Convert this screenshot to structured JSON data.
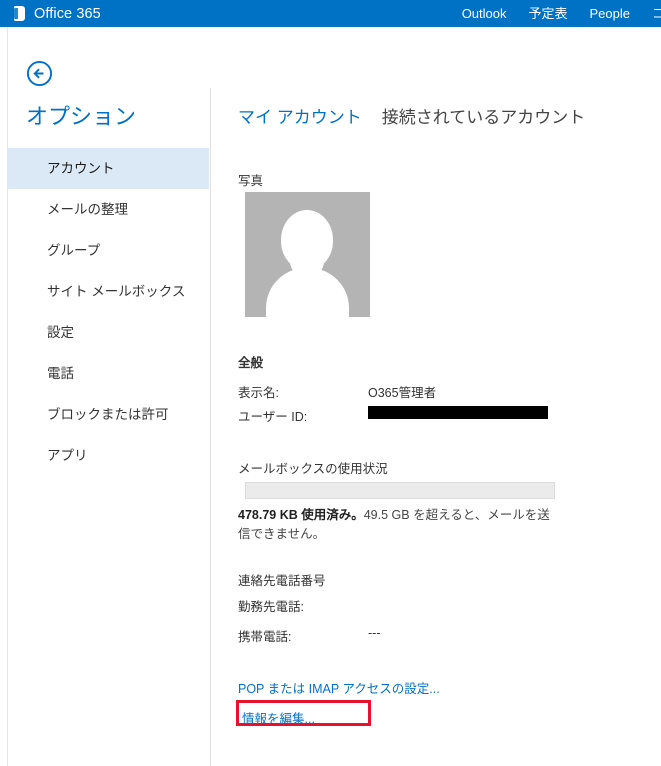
{
  "suitebar": {
    "brand": "Office 365",
    "brand_icon": "office-logo-icon",
    "nav": [
      {
        "label": "Outlook"
      },
      {
        "label": "予定表"
      },
      {
        "label": "People"
      },
      {
        "label": "コ"
      }
    ]
  },
  "sidebar": {
    "back_icon": "back-arrow-circle-icon",
    "title": "オプション",
    "items": [
      {
        "label": "アカウント",
        "selected": true
      },
      {
        "label": "メールの整理",
        "selected": false
      },
      {
        "label": "グループ",
        "selected": false
      },
      {
        "label": "サイト メールボックス",
        "selected": false
      },
      {
        "label": "設定",
        "selected": false
      },
      {
        "label": "電話",
        "selected": false
      },
      {
        "label": "ブロックまたは許可",
        "selected": false
      },
      {
        "label": "アプリ",
        "selected": false
      }
    ]
  },
  "content": {
    "tabs": [
      {
        "label": "マイ アカウント",
        "active": true
      },
      {
        "label": "接続されているアカウント",
        "active": false
      }
    ],
    "photo": {
      "label": "写真",
      "avatar_icon": "person-placeholder-icon"
    },
    "general": {
      "label": "全般",
      "display_name_key": "表示名:",
      "display_name_value": "O365管理者",
      "user_id_key": "ユーザー ID:",
      "user_id_value": ""
    },
    "mailbox_usage": {
      "label": "メールボックスの使用状況",
      "used": "478.79 KB 使用済み。",
      "limit_text": "49.5 GB を超えると、メールを送信できません。",
      "percent": 0
    },
    "phone": {
      "label": "連絡先電話番号",
      "work_key": "勤務先電話:",
      "work_value": "",
      "mobile_key": "携帯電話:",
      "mobile_value": "---"
    },
    "links": {
      "pop_imap": "POP または IMAP アクセスの設定...",
      "edit_info": "情報を編集..."
    }
  },
  "colors": {
    "suitebar_blue": "#0072c6",
    "accent_link": "#0072c6",
    "selected_nav_bg": "#dbe9f7",
    "highlight_box": "#e8112d",
    "avatar_gray": "#b4b4b4"
  }
}
